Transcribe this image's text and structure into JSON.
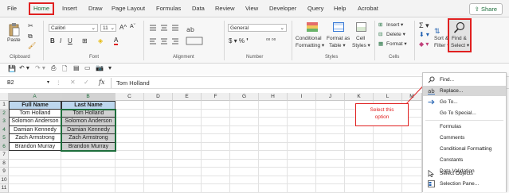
{
  "tabs": [
    "File",
    "Home",
    "Insert",
    "Draw",
    "Page Layout",
    "Formulas",
    "Data",
    "Review",
    "View",
    "Developer",
    "Query",
    "Help",
    "Acrobat"
  ],
  "share_label": "Share",
  "ribbon": {
    "paste_label": "Paste",
    "font_name": "Calibri",
    "font_size": "11",
    "number_format": "General",
    "conditional_formatting": [
      "Conditional",
      "Formatting ▾"
    ],
    "format_as_table": [
      "Format as",
      "Table ▾"
    ],
    "cell_styles": [
      "Cell",
      "Styles ▾"
    ],
    "insert_label": "Insert ▾",
    "delete_label": "Delete ▾",
    "format_label": "Format ▾",
    "sort_filter": [
      "Sort &",
      "Filter ▾"
    ],
    "find_select": [
      "Find &",
      "Select ▾"
    ],
    "group_labels": {
      "clipboard": "Clipboard",
      "font": "Font",
      "alignment": "Alignment",
      "number": "Number",
      "styles": "Styles",
      "cells": "Cells"
    },
    "accent_color": "#1e6e3c",
    "highlight_red": "#e02020"
  },
  "formula_bar": {
    "name_box": "B2",
    "fx": "fx",
    "content": "Tom Holland"
  },
  "grid": {
    "columns": [
      "A",
      "B",
      "C",
      "D",
      "E",
      "F",
      "G",
      "H",
      "I",
      "J",
      "K",
      "L",
      "M"
    ],
    "rows": [
      "1",
      "2",
      "3",
      "4",
      "5",
      "6",
      "7",
      "8",
      "9",
      "10",
      "11"
    ],
    "headers": [
      "Full Name",
      "Last Name"
    ],
    "data": [
      [
        "Tom Holland",
        "Tom Holland"
      ],
      [
        "Solomon Anderson",
        "Solomon Anderson"
      ],
      [
        "Damian Kennedy",
        "Damian Kennedy"
      ],
      [
        "Zach Armstrong",
        "Zach Armstrong"
      ],
      [
        "Brandon Murray",
        "Brandon Murray"
      ]
    ]
  },
  "callout": [
    "Select this",
    "option"
  ],
  "menu": {
    "items": [
      {
        "label": "Find...",
        "icon": "search-icon"
      },
      {
        "label": "Replace...",
        "icon": "replace-icon"
      },
      {
        "label": "Go To...",
        "icon": "arrow-right-icon"
      },
      {
        "label": "Go To Special...",
        "icon": ""
      },
      {
        "label": "Formulas",
        "icon": ""
      },
      {
        "label": "Comments",
        "icon": ""
      },
      {
        "label": "Conditional Formatting",
        "icon": ""
      },
      {
        "label": "Constants",
        "icon": ""
      },
      {
        "label": "Data Validation",
        "icon": ""
      },
      {
        "label": "Select Objects",
        "icon": "cursor-icon"
      },
      {
        "label": "Selection Pane...",
        "icon": "selection-pane-icon"
      }
    ]
  }
}
